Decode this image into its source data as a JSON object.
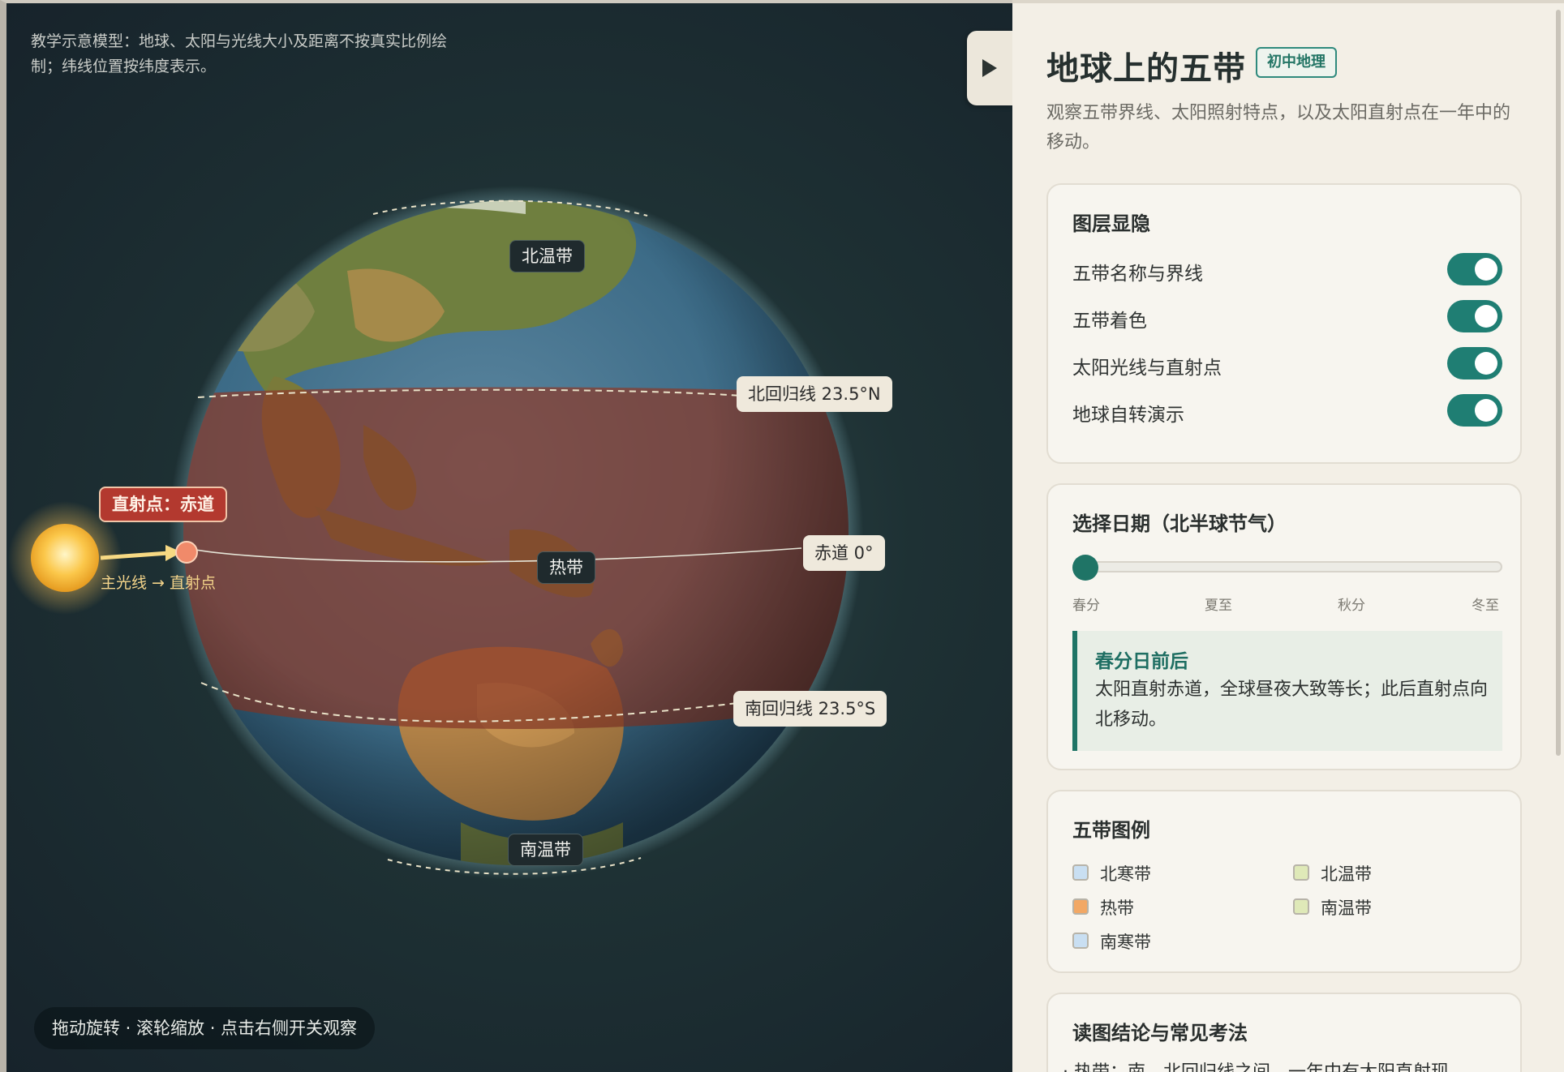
{
  "stage": {
    "note": "教学示意模型：地球、太阳与光线大小及距离不按真实比例绘制；纬线位置按纬度表示。",
    "hint": "拖动旋转 · 滚轮缩放 · 点击右侧开关观察",
    "zone_labels": {
      "north_temperate": "北温带",
      "tropical": "热带",
      "south_temperate": "南温带"
    },
    "line_labels": {
      "tropic_cancer": "北回归线 23.5°N",
      "equator": "赤道 0°",
      "tropic_capricorn": "南回归线 23.5°S"
    },
    "subsolar_tag": "直射点：赤道",
    "ray_label": "主光线 → 直射点",
    "colors": {
      "tropical_band": "#8a3a2a",
      "sun": "#f7b733",
      "subsolar_point": "#f08a6a",
      "ocean": "#3a6a8c",
      "land": "#6b7d3d"
    }
  },
  "panel": {
    "title": "地球上的五带",
    "badge": "初中地理",
    "desc": "观察五带界线、太阳照射特点，以及太阳直射点在一年中的移动。",
    "collapse_icon": "play-triangle-icon",
    "layers": {
      "heading": "图层显隐",
      "items": [
        {
          "label": "五带名称与界线",
          "on": true
        },
        {
          "label": "五带着色",
          "on": true
        },
        {
          "label": "太阳光线与直射点",
          "on": true
        },
        {
          "label": "地球自转演示",
          "on": true
        }
      ]
    },
    "date": {
      "heading": "选择日期（北半球节气）",
      "ticks": [
        "春分",
        "夏至",
        "秋分",
        "冬至"
      ],
      "slider_value": 0,
      "info_title": "春分日前后",
      "info_body": "太阳直射赤道，全球昼夜大致等长；此后直射点向北移动。"
    },
    "legend": {
      "heading": "五带图例",
      "items": [
        {
          "label": "北寒带",
          "color": "#c9dff2"
        },
        {
          "label": "北温带",
          "color": "#dfe9b8"
        },
        {
          "label": "热带",
          "color": "#f2a865"
        },
        {
          "label": "南温带",
          "color": "#dfe9b8"
        },
        {
          "label": "南寒带",
          "color": "#c9dff2"
        }
      ]
    },
    "conclusions": {
      "heading": "读图结论与常见考法",
      "first_item": "· 热带：南、北回归线之间，一年中有太阳直射现"
    }
  }
}
